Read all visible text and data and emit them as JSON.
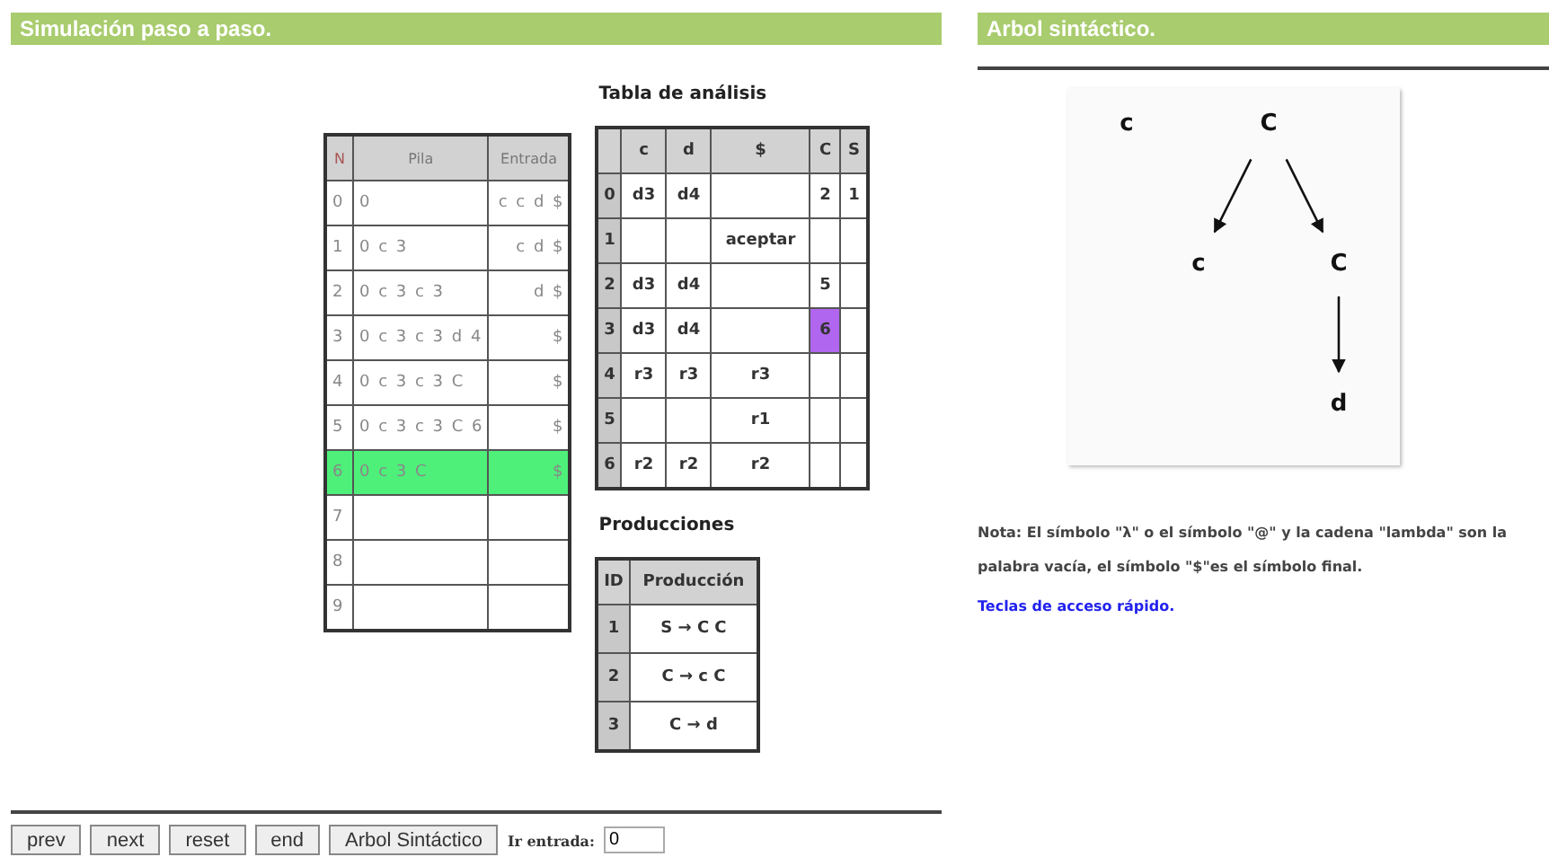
{
  "simulation": {
    "title": "Simulación paso a paso.",
    "stack_table": {
      "columns": [
        "N",
        "Pila",
        "Entrada"
      ],
      "rows": [
        {
          "n": "0",
          "pila": "0",
          "entrada": "c c d $",
          "selected": false
        },
        {
          "n": "1",
          "pila": "0 c 3",
          "entrada": "c d $",
          "selected": false
        },
        {
          "n": "2",
          "pila": "0 c 3 c 3",
          "entrada": "d $",
          "selected": false
        },
        {
          "n": "3",
          "pila": "0 c 3 c 3 d 4",
          "entrada": "$",
          "selected": false
        },
        {
          "n": "4",
          "pila": "0 c 3 c 3 C",
          "entrada": "$",
          "selected": false
        },
        {
          "n": "5",
          "pila": "0 c 3 c 3 C 6",
          "entrada": "$",
          "selected": false
        },
        {
          "n": "6",
          "pila": "0 c 3 C",
          "entrada": "$",
          "selected": true
        },
        {
          "n": "7",
          "selected": false
        },
        {
          "n": "8",
          "selected": false
        },
        {
          "n": "9",
          "selected": false
        }
      ]
    },
    "analysis_table": {
      "title": "Tabla de análisis",
      "columns": [
        "c",
        "d",
        "$",
        "C",
        "S"
      ],
      "rows": [
        {
          "state": "0",
          "cells": [
            {
              "text": "d3",
              "selected": false
            },
            {
              "text": "d4",
              "selected": false
            },
            null,
            {
              "text": "2",
              "selected": false
            },
            {
              "text": "1",
              "selected": false
            }
          ]
        },
        {
          "state": "1",
          "cells": [
            null,
            null,
            {
              "text": "aceptar",
              "selected": false
            },
            null,
            null
          ]
        },
        {
          "state": "2",
          "cells": [
            {
              "text": "d3",
              "selected": false
            },
            {
              "text": "d4",
              "selected": false
            },
            null,
            {
              "text": "5",
              "selected": false
            },
            null
          ]
        },
        {
          "state": "3",
          "cells": [
            {
              "text": "d3",
              "selected": false
            },
            {
              "text": "d4",
              "selected": false
            },
            null,
            {
              "text": "6",
              "selected": true
            },
            null
          ]
        },
        {
          "state": "4",
          "cells": [
            {
              "text": "r3",
              "selected": false
            },
            {
              "text": "r3",
              "selected": false
            },
            {
              "text": "r3",
              "selected": false
            },
            null,
            null
          ]
        },
        {
          "state": "5",
          "cells": [
            null,
            null,
            {
              "text": "r1",
              "selected": false
            },
            null,
            null
          ]
        },
        {
          "state": "6",
          "cells": [
            {
              "text": "r2",
              "selected": false
            },
            {
              "text": "r2",
              "selected": false
            },
            {
              "text": "r2",
              "selected": false
            },
            null,
            null
          ]
        }
      ]
    },
    "productions": {
      "title": "Producciones",
      "columns": [
        "ID",
        "Producción"
      ],
      "rows": [
        {
          "id": "1",
          "production": "S → C C"
        },
        {
          "id": "2",
          "production": "C → c C"
        },
        {
          "id": "3",
          "production": "C → d"
        }
      ]
    },
    "buttons": [
      "prev",
      "next",
      "reset",
      "end",
      "Arbol Sintáctico"
    ],
    "goto": {
      "label": "Ir entrada:",
      "value": "0"
    }
  },
  "tree": {
    "title": "Arbol sintáctico.",
    "nodes": [
      {
        "label": "c"
      },
      {
        "label": "C",
        "children": [
          {
            "label": "c"
          },
          {
            "label": "C",
            "children": [
              {
                "label": "d"
              }
            ]
          }
        ]
      }
    ],
    "note": "Nota: El símbolo \"λ\" o el símbolo \"@\" y la cadena \"lambda\" son la palabra vacía, el símbolo \"$\"es el símbolo final.",
    "link": "Teclas de acceso rápido."
  }
}
